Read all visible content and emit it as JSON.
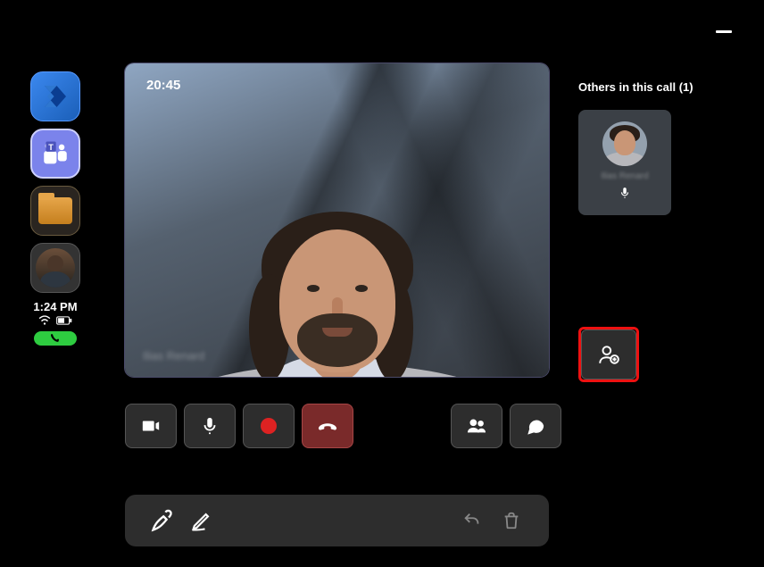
{
  "window": {
    "minimize": "–"
  },
  "sidebar": {
    "items": [
      {
        "name": "dynamics",
        "label": "Dynamics 365"
      },
      {
        "name": "teams",
        "label": "Microsoft Teams"
      },
      {
        "name": "files",
        "label": "Files"
      },
      {
        "name": "avatar",
        "label": "User avatar"
      }
    ],
    "time": "1:24 PM",
    "status": {
      "wifi": true,
      "battery": true,
      "in_call": true
    }
  },
  "video": {
    "duration": "20:45",
    "participant_name": "Ilias Renard"
  },
  "participants": {
    "header": "Others in this call (1)",
    "items": [
      {
        "name": "Ilias Renard",
        "mic": "unmuted"
      }
    ]
  },
  "controls": {
    "camera": "Camera",
    "mic": "Microphone",
    "record": "Record",
    "hangup": "Hang up",
    "people": "People",
    "chat": "Chat"
  },
  "add_people": {
    "label": "Add people"
  },
  "pen_bar": {
    "pen": "Pen",
    "marker": "Marker",
    "undo": "Undo",
    "delete": "Delete"
  }
}
